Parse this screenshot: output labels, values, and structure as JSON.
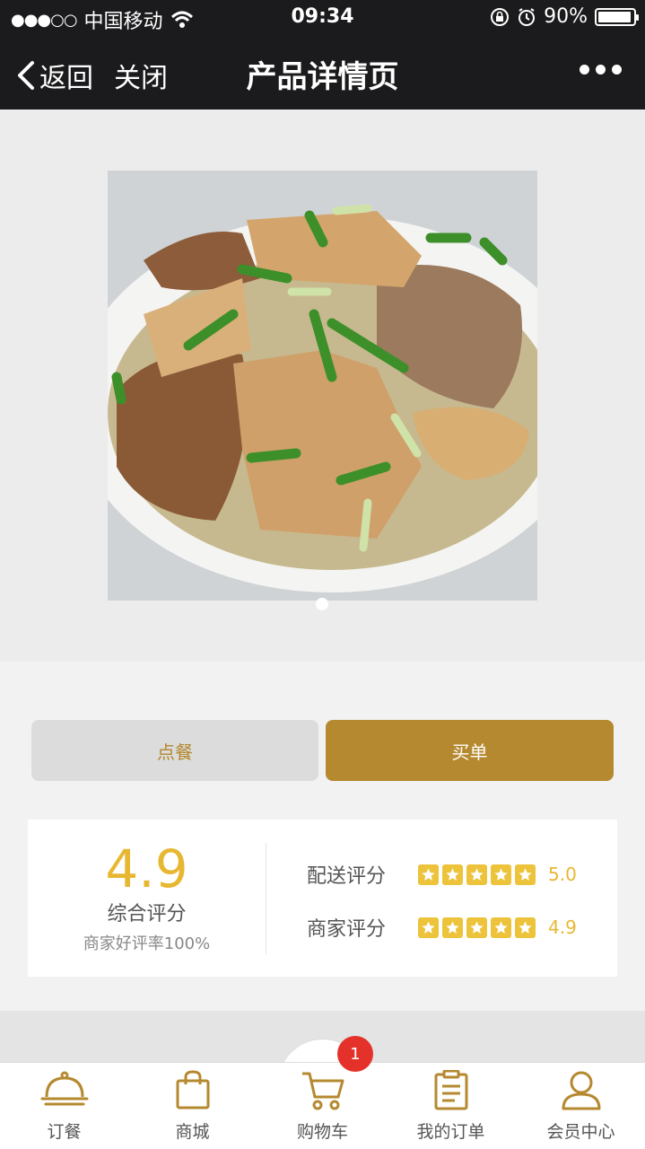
{
  "status_bar": {
    "signal": "●●●○○",
    "carrier": "中国移动",
    "time": "09:34",
    "battery": "90%"
  },
  "nav": {
    "back_label": "返回",
    "close_label": "关闭",
    "title": "产品详情页"
  },
  "actions": {
    "order_label": "点餐",
    "pay_label": "买单"
  },
  "rating": {
    "overall_score": "4.9",
    "overall_label": "综合评分",
    "positive_rate": "商家好评率100%",
    "delivery_label": "配送评分",
    "delivery_score": "5.0",
    "merchant_label": "商家评分",
    "merchant_score": "4.9",
    "stars_count": 5
  },
  "tabs": [
    {
      "label": "订餐",
      "icon": "cloche-icon"
    },
    {
      "label": "商城",
      "icon": "shopping-bag-icon"
    },
    {
      "label": "购物车",
      "icon": "cart-icon"
    },
    {
      "label": "我的订单",
      "icon": "clipboard-icon"
    },
    {
      "label": "会员中心",
      "icon": "user-icon"
    }
  ],
  "cart_badge": "1",
  "colors": {
    "accent": "#b5892f",
    "star": "#ecc33a",
    "badge": "#e4322b",
    "header": "#1b1b1d"
  }
}
